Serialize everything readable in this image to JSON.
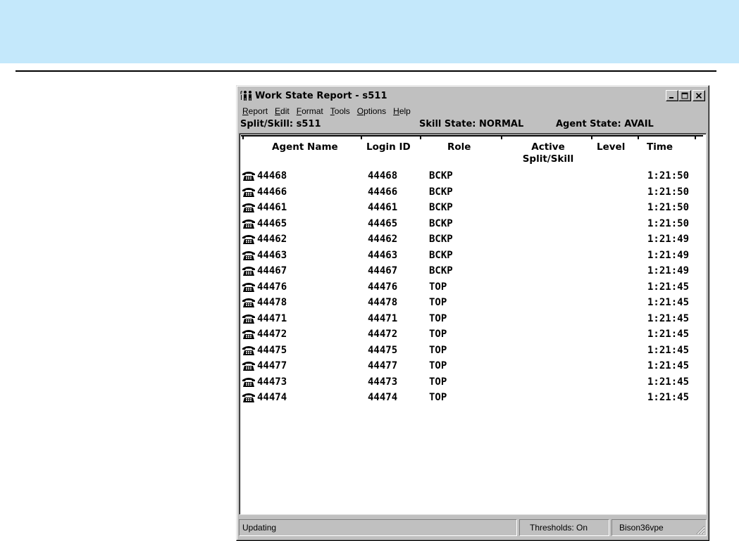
{
  "window": {
    "title": "Work State Report - s511",
    "controls": {
      "minimize": "_",
      "maximize": "□",
      "close": "×"
    }
  },
  "menu": [
    {
      "id": "report",
      "underline": "R",
      "rest": "eport"
    },
    {
      "id": "edit",
      "underline": "E",
      "rest": "dit"
    },
    {
      "id": "format",
      "underline": "F",
      "rest": "ormat"
    },
    {
      "id": "tools",
      "underline": "T",
      "rest": "ools"
    },
    {
      "id": "options",
      "underline": "O",
      "rest": "ptions"
    },
    {
      "id": "help",
      "underline": "H",
      "rest": "elp"
    }
  ],
  "info": {
    "split_skill": "Split/Skill:  s511",
    "skill_state": "Skill State:  NORMAL",
    "agent_state": "Agent State:  AVAIL"
  },
  "columns": {
    "agent_name": "Agent Name",
    "login_id": "Login ID",
    "role": "Role",
    "active_split_skill_1": "Active",
    "active_split_skill_2": "Split/Skill",
    "level": "Level",
    "time": "Time"
  },
  "rows": [
    {
      "agent": "44468",
      "login": "44468",
      "role": "BCKP",
      "active": "",
      "level": "",
      "time": "1:21:50"
    },
    {
      "agent": "44466",
      "login": "44466",
      "role": "BCKP",
      "active": "",
      "level": "",
      "time": "1:21:50"
    },
    {
      "agent": "44461",
      "login": "44461",
      "role": "BCKP",
      "active": "",
      "level": "",
      "time": "1:21:50"
    },
    {
      "agent": "44465",
      "login": "44465",
      "role": "BCKP",
      "active": "",
      "level": "",
      "time": "1:21:50"
    },
    {
      "agent": "44462",
      "login": "44462",
      "role": "BCKP",
      "active": "",
      "level": "",
      "time": "1:21:49"
    },
    {
      "agent": "44463",
      "login": "44463",
      "role": "BCKP",
      "active": "",
      "level": "",
      "time": "1:21:49"
    },
    {
      "agent": "44467",
      "login": "44467",
      "role": "BCKP",
      "active": "",
      "level": "",
      "time": "1:21:49"
    },
    {
      "agent": "44476",
      "login": "44476",
      "role": "TOP",
      "active": "",
      "level": "",
      "time": "1:21:45"
    },
    {
      "agent": "44478",
      "login": "44478",
      "role": "TOP",
      "active": "",
      "level": "",
      "time": "1:21:45"
    },
    {
      "agent": "44471",
      "login": "44471",
      "role": "TOP",
      "active": "",
      "level": "",
      "time": "1:21:45"
    },
    {
      "agent": "44472",
      "login": "44472",
      "role": "TOP",
      "active": "",
      "level": "",
      "time": "1:21:45"
    },
    {
      "agent": "44475",
      "login": "44475",
      "role": "TOP",
      "active": "",
      "level": "",
      "time": "1:21:45"
    },
    {
      "agent": "44477",
      "login": "44477",
      "role": "TOP",
      "active": "",
      "level": "",
      "time": "1:21:45"
    },
    {
      "agent": "44473",
      "login": "44473",
      "role": "TOP",
      "active": "",
      "level": "",
      "time": "1:21:45"
    },
    {
      "agent": "44474",
      "login": "44474",
      "role": "TOP",
      "active": "",
      "level": "",
      "time": "1:21:45"
    }
  ],
  "status": {
    "message": "Updating",
    "thresholds": "Thresholds: On",
    "server": "Bison36vpe"
  },
  "icons": {
    "app": "agents-icon",
    "row": "phone-icon",
    "grip": "resize-grip-icon"
  },
  "colors": {
    "page_band": "#c4e8fb",
    "window_face": "#c0c0c0",
    "report_bg": "#ffffff"
  }
}
